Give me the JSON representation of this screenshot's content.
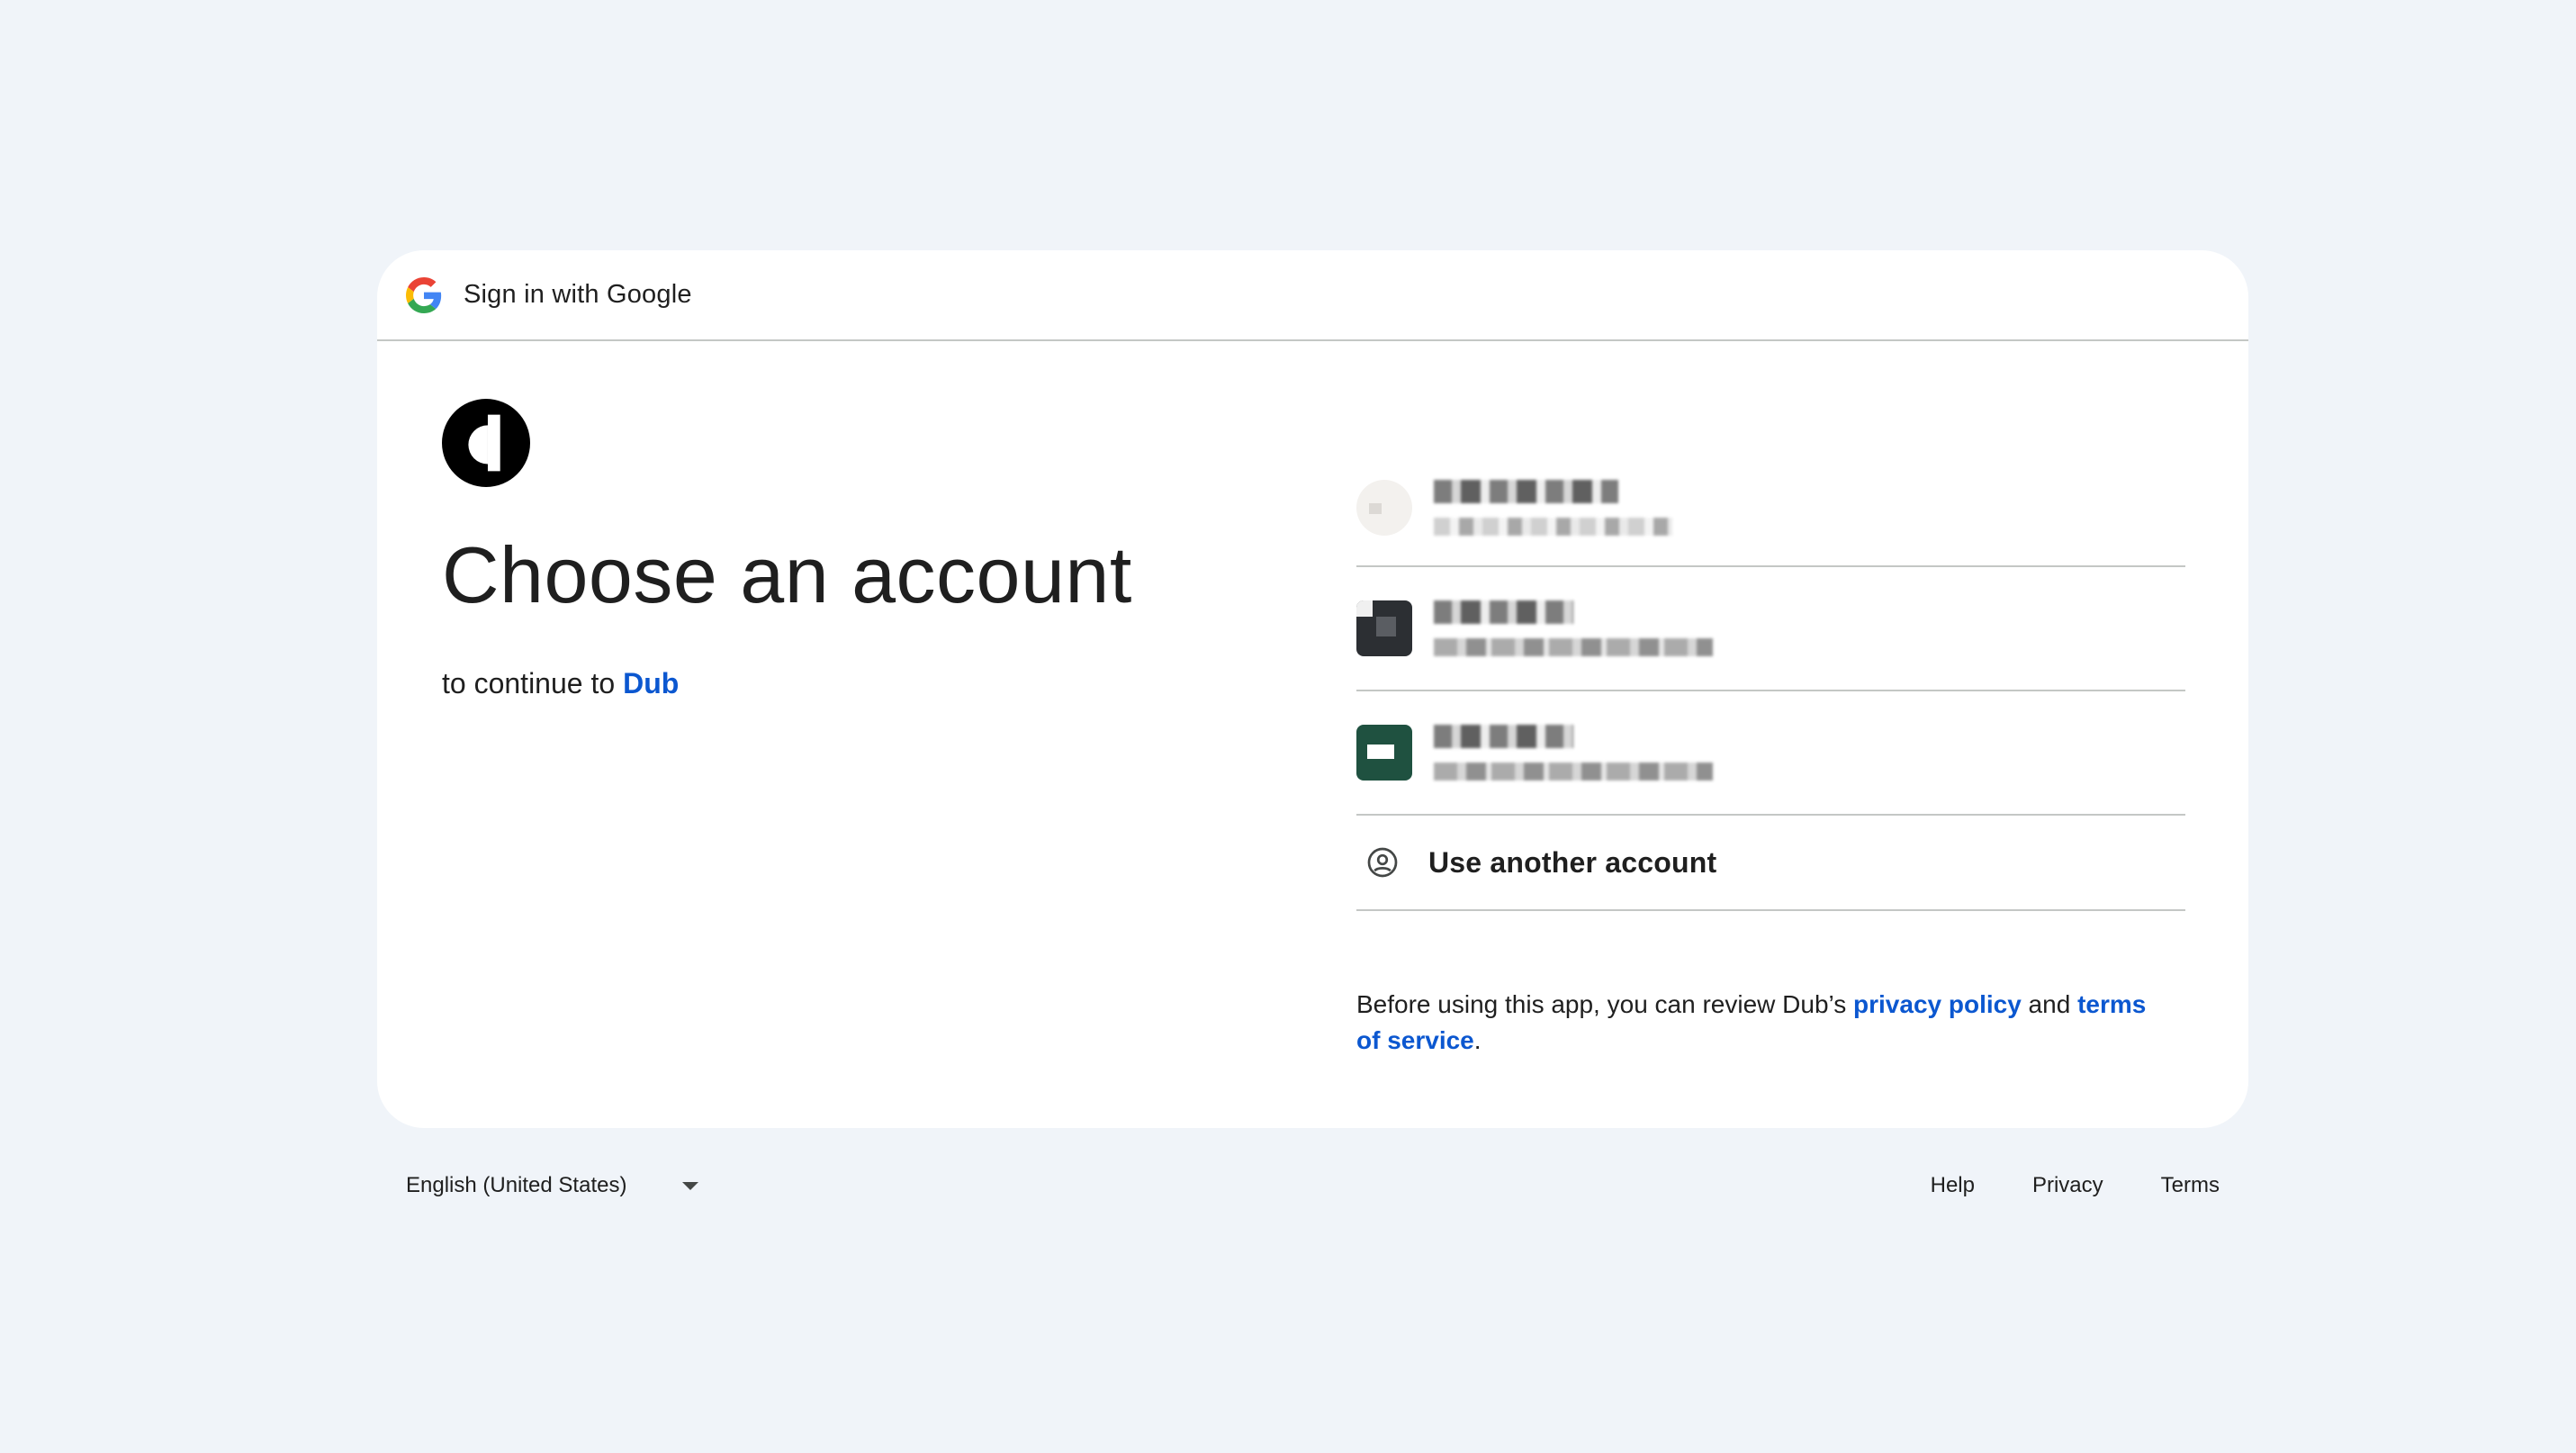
{
  "header": {
    "title": "Sign in with Google",
    "logo_icon": "google-g-icon"
  },
  "main": {
    "app_logo_icon": "dub-logo-icon",
    "title": "Choose an account",
    "subtitle_prefix": "to continue to",
    "app_name": "Dub"
  },
  "accounts": [
    {
      "avatar_icon": "account-avatar-1",
      "name": "",
      "email": ""
    },
    {
      "avatar_icon": "account-avatar-2",
      "name": "",
      "email": ""
    },
    {
      "avatar_icon": "account-avatar-3",
      "name": "",
      "email": ""
    }
  ],
  "use_another": {
    "label": "Use another account",
    "icon": "person-circle-icon"
  },
  "disclaimer": {
    "prefix": "Before using this app, you can review Dub’s ",
    "privacy_link": "privacy policy",
    "middle": " and ",
    "terms_link": "terms of service",
    "suffix": "."
  },
  "footer": {
    "language": "English (United States)",
    "help": "Help",
    "privacy": "Privacy",
    "terms": "Terms"
  },
  "colors": {
    "background": "#f0f4f9",
    "link": "#0b57d0",
    "divider": "#c4c7c5"
  }
}
